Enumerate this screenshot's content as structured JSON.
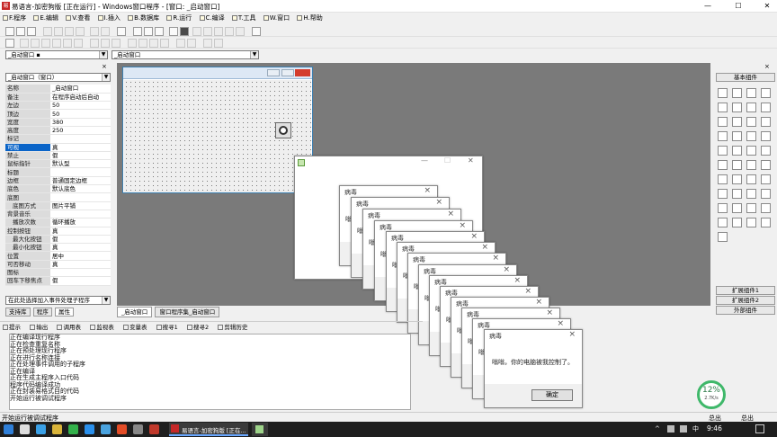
{
  "window": {
    "title": "易语言-加密狗版 [正在运行] - Windows窗口程序 - [窗口: _启动窗口]",
    "min": "—",
    "max": "☐",
    "close": "✕"
  },
  "menu": [
    {
      "label": "F.程序"
    },
    {
      "label": "E.编辑"
    },
    {
      "label": "V.查看"
    },
    {
      "label": "I.插入"
    },
    {
      "label": "B.数据库"
    },
    {
      "label": "R.运行"
    },
    {
      "label": "C.编译"
    },
    {
      "label": "T.工具"
    },
    {
      "label": "W.窗口"
    },
    {
      "label": "H.帮助"
    }
  ],
  "toolbar": {
    "combo1": "_启动窗口 ▪",
    "combo2": "_启动窗口"
  },
  "left_panel": {
    "combo": "_启动窗口（窗口）",
    "properties": [
      {
        "name": "名称",
        "value": "_启动窗口"
      },
      {
        "name": "备注",
        "value": "在程序启动后自动"
      },
      {
        "name": "左边",
        "value": "50"
      },
      {
        "name": "顶边",
        "value": "50"
      },
      {
        "name": "宽度",
        "value": "380"
      },
      {
        "name": "高度",
        "value": "250"
      },
      {
        "name": "标记",
        "value": ""
      },
      {
        "name": "可视",
        "value": "真"
      },
      {
        "name": "禁止",
        "value": "假"
      },
      {
        "name": "鼠标指针",
        "value": "默认型"
      },
      {
        "name": "标题",
        "value": ""
      },
      {
        "name": "边框",
        "value": "普通固定边框"
      },
      {
        "name": "底色",
        "value": "默认底色"
      },
      {
        "name": "底图",
        "value": ""
      },
      {
        "name": "底图方式",
        "value": "图片平铺"
      },
      {
        "name": "背景音乐",
        "value": ""
      },
      {
        "name": "播放次数",
        "value": "循环播放"
      },
      {
        "name": "控制按钮",
        "value": "真"
      },
      {
        "name": "最大化按钮",
        "value": "假"
      },
      {
        "name": "最小化按钮",
        "value": "真"
      },
      {
        "name": "位置",
        "value": "居中"
      },
      {
        "name": "可否移动",
        "value": "真"
      },
      {
        "name": "图标",
        "value": ""
      },
      {
        "name": "回车下移焦点",
        "value": "假"
      }
    ],
    "event_combo": "在此处选择加入事件处理子程序",
    "tabs": [
      "支持库",
      "程序",
      "属性"
    ]
  },
  "designer_tabs": [
    "_启动窗口",
    "窗口程序集_启动窗口"
  ],
  "main_dialog": {
    "title": "",
    "min": "—",
    "max": "☐",
    "close": "✕"
  },
  "virus_dialogs": {
    "title": "病毒",
    "message": "嗡嗡，你的电脑被我控制了。",
    "ok": "确定"
  },
  "right_panel": {
    "header": "基本组件",
    "ext1": "扩展组件1",
    "ext2": "扩展组件2",
    "external": "外部组件"
  },
  "bottom_tabs": [
    "提示",
    "输出",
    "调用表",
    "监视表",
    "变量表",
    "搜寻1",
    "搜寻2",
    "剪辑历史"
  ],
  "output_lines": [
    "正在编译现行程序",
    "正在检查重复名称",
    "正在预处理现行程序",
    "正在进行名称连接",
    "正在处理事件调用的子程序",
    "正在编译",
    "正在生成主程序入口代码",
    "程序代码编译成功",
    "正在封装易格式目的代码",
    "开始运行被调试程序"
  ],
  "status": {
    "left": "开始运行被调试程序",
    "mid": "总出",
    "right": "总出"
  },
  "netbadge": {
    "percent": "12%",
    "speed": "2.7K/s"
  },
  "taskbar": {
    "app_label": "易语言-加密狗版 [正在...",
    "clock": "9:46",
    "ime": "中"
  }
}
